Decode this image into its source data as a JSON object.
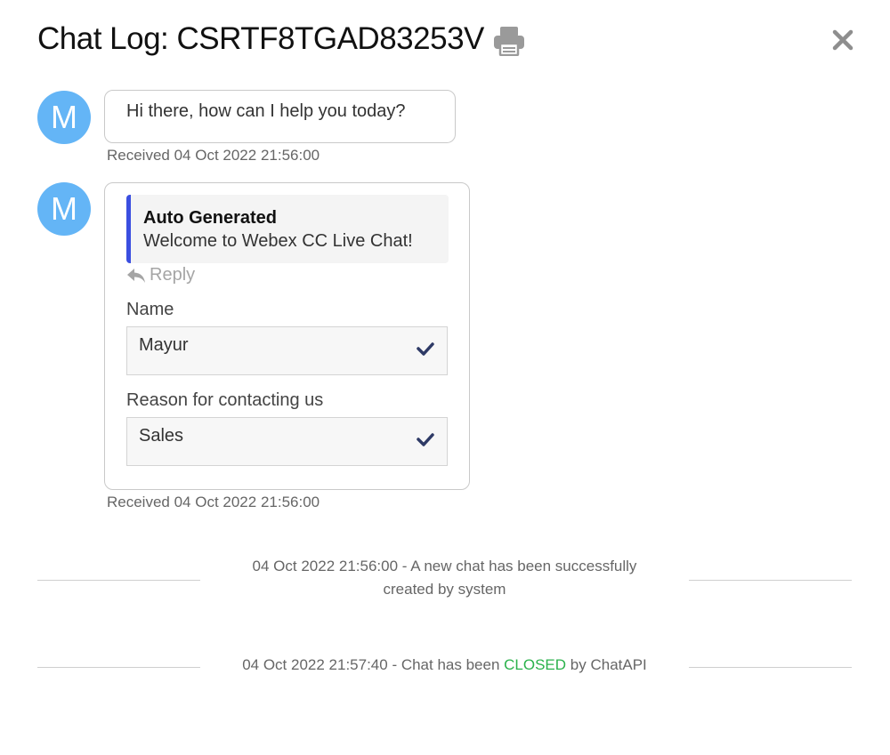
{
  "header": {
    "title": "Chat Log: CSRTF8TGAD83253V",
    "print_icon": "print-icon",
    "close_icon": "close-icon"
  },
  "messages": [
    {
      "avatar": "M",
      "text": "Hi there, how can I help you today?",
      "timestamp": "Received 04 Oct 2022 21:56:00"
    },
    {
      "avatar": "M",
      "quote": {
        "title": "Auto Generated",
        "text": "Welcome to Webex CC Live Chat!"
      },
      "reply_label": "Reply",
      "fields": [
        {
          "label": "Name",
          "value": "Mayur"
        },
        {
          "label": "Reason for contacting us",
          "value": "Sales"
        }
      ],
      "timestamp": "Received 04 Oct 2022 21:56:00"
    }
  ],
  "system_events": [
    {
      "line1": "04 Oct 2022 21:56:00 - A new chat has been successfully",
      "line2": "created by system"
    },
    {
      "prefix": "04 Oct 2022 21:57:40 - Chat has been ",
      "status": "CLOSED",
      "suffix": " by ChatAPI"
    }
  ],
  "colors": {
    "avatar": "#64b5f6",
    "quote_accent": "#3b4fe0",
    "closed": "#2bb24c",
    "check": "#2e3a66"
  }
}
